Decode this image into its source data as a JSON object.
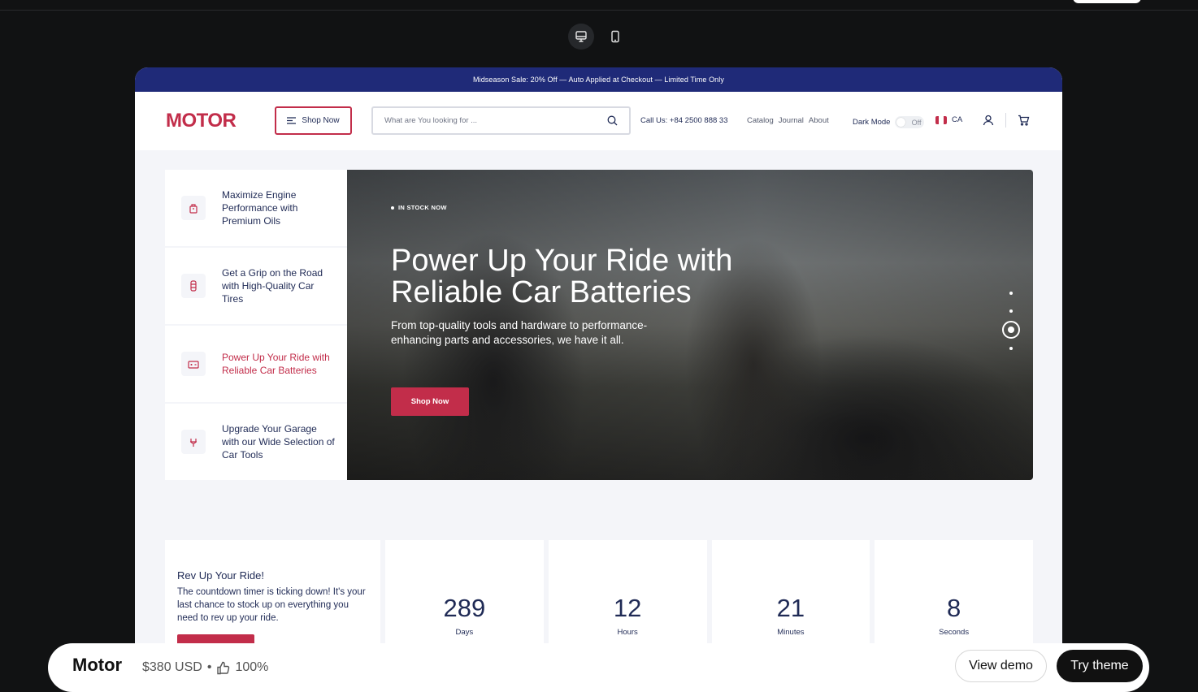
{
  "announcement": "Midseason Sale: 20% Off — Auto Applied at Checkout — Limited Time Only",
  "header": {
    "logo": "MOTOR",
    "shop_now": "Shop Now",
    "search_placeholder": "What are You looking for ...",
    "call_label": "Call Us:",
    "call_number": "+84 2500 888 33",
    "nav": [
      "Catalog",
      "Journal",
      "About"
    ],
    "dark_mode_label": "Dark Mode",
    "dark_mode_state": "Off",
    "locale": "CA"
  },
  "sidebar": {
    "items": [
      {
        "label": "Maximize Engine Performance with Premium Oils",
        "icon": "oil-can-icon"
      },
      {
        "label": "Get a Grip on the Road with High-Quality Car Tires",
        "icon": "tire-icon"
      },
      {
        "label": "Power Up Your Ride with Reliable Car Batteries",
        "icon": "battery-icon"
      },
      {
        "label": "Upgrade Your Garage with our Wide Selection of Car Tools",
        "icon": "tool-icon"
      }
    ],
    "active_index": 2
  },
  "hero": {
    "badge": "IN STOCK NOW",
    "title": "Power Up Your Ride with Reliable Car Batteries",
    "subtitle": "From top-quality tools and hardware to performance-enhancing parts and accessories, we have it all.",
    "button": "Shop Now",
    "slide_count": 4,
    "active_slide": 3
  },
  "countdown": {
    "title": "Rev Up Your Ride!",
    "text": "The countdown timer is ticking down! It's your last chance to stock up on everything you need to rev up your ride.",
    "units": [
      {
        "value": "289",
        "label": "Days"
      },
      {
        "value": "12",
        "label": "Hours"
      },
      {
        "value": "21",
        "label": "Minutes"
      },
      {
        "value": "8",
        "label": "Seconds"
      }
    ]
  },
  "bottom_bar": {
    "name": "Motor",
    "price": "$380 USD",
    "separator": "•",
    "rating": "100%",
    "view_demo": "View demo",
    "try_theme": "Try theme"
  },
  "colors": {
    "accent": "#c22d4a",
    "navy": "#1f2a78",
    "text": "#1f2a55",
    "page_bg": "#111213"
  }
}
